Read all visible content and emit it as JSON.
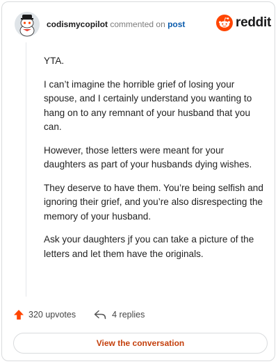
{
  "header": {
    "username": "codismycopilot",
    "commented_text": "commented on",
    "post_link": "post",
    "logo_text": "reddit"
  },
  "comment": {
    "paragraphs": [
      "YTA.",
      "I can’t imagine the horrible grief of losing your spouse, and I certainly understand you wanting to hang on to any remnant of your husband that you can.",
      "However, those letters were meant for your daughters as part of your husbands dying wishes.",
      "They deserve to have them. You’re being selfish and ignoring their grief, and you’re also disrespecting the memory of your husband.",
      "Ask your daughters jf you can take a picture of the letters and let them have the originals."
    ]
  },
  "actions": {
    "upvotes": "320 upvotes",
    "replies": "4 replies"
  },
  "view_button": "View the conversation",
  "icons": {
    "avatar": "snoo-avatar",
    "logo": "reddit-logo",
    "upvote": "upvote-arrow-icon",
    "reply": "reply-arrow-icon"
  },
  "colors": {
    "brand": "#ff4500",
    "link": "#0b5cad",
    "button_text": "#c4400d"
  }
}
